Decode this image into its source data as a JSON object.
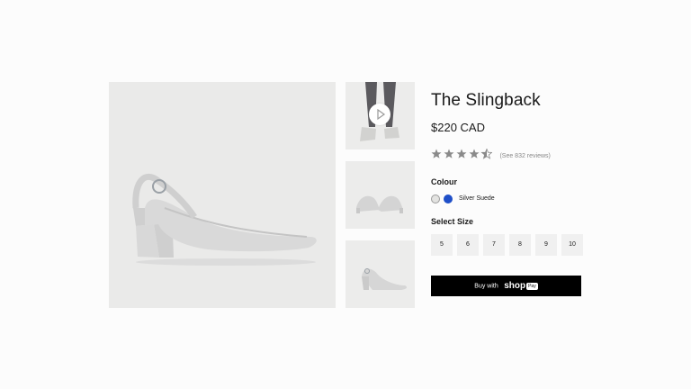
{
  "product": {
    "title": "The Slingback",
    "price": "$220 CAD",
    "rating": 4.5,
    "reviews_text": "(See 832 reviews)"
  },
  "colour": {
    "label": "Colour",
    "selected_name": "Silver Suede",
    "options": [
      {
        "name": "silver",
        "hex": "#e3e3e1"
      },
      {
        "name": "blue",
        "hex": "#1f4fc8"
      }
    ]
  },
  "size": {
    "label": "Select Size",
    "options": [
      "5",
      "6",
      "7",
      "8",
      "9",
      "10"
    ]
  },
  "buy": {
    "label": "Buy with",
    "brand": "shop",
    "badge": "Pay"
  },
  "colors": {
    "star": "#8a8a8a",
    "button_bg": "#000000"
  }
}
